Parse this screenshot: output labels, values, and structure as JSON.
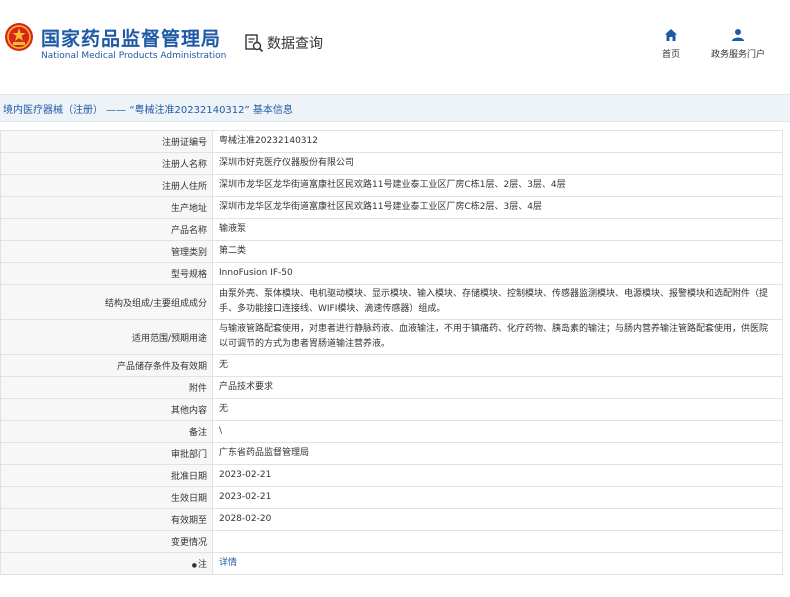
{
  "header": {
    "site_name_cn": "国家药品监督管理局",
    "site_name_en": "National Medical Products Administration",
    "query_title": "数据查询",
    "nav": [
      {
        "label": "首页",
        "icon": "home-icon"
      },
      {
        "label": "政务服务门户",
        "icon": "user-icon"
      }
    ]
  },
  "breadcrumb": "境内医疗器械（注册） —— “粤械注准20232140312” 基本信息",
  "rows": [
    {
      "label": "注册证编号",
      "value": "粤械注准20232140312"
    },
    {
      "label": "注册人名称",
      "value": "深圳市好克医疗仪器股份有限公司"
    },
    {
      "label": "注册人住所",
      "value": "深圳市龙华区龙华街道富康社区民欢路11号建业泰工业区厂房C栋1层、2层、3层、4层"
    },
    {
      "label": "生产地址",
      "value": "深圳市龙华区龙华街道富康社区民欢路11号建业泰工业区厂房C栋2层、3层、4层"
    },
    {
      "label": "产品名称",
      "value": "输液泵"
    },
    {
      "label": "管理类别",
      "value": "第二类"
    },
    {
      "label": "型号规格",
      "value": "InnoFusion IF-50"
    },
    {
      "label": "结构及组成/主要组成成分",
      "value": "由泵外壳、泵体模块、电机驱动模块、显示模块、输入模块、存储模块、控制模块、传感器监测模块、电源模块、报警模块和选配附件（提手、多功能接口连接线、WIFI模块、滴速传感器）组成。"
    },
    {
      "label": "适用范围/预期用途",
      "value": "与输液管路配套使用，对患者进行静脉药液、血液输注，不用于镇痛药、化疗药物、胰岛素的输注；与肠内营养输注管路配套使用，供医院以可调节的方式为患者胃肠道输注营养液。"
    },
    {
      "label": "产品储存条件及有效期",
      "value": "无"
    },
    {
      "label": "附件",
      "value": "产品技术要求"
    },
    {
      "label": "其他内容",
      "value": "无"
    },
    {
      "label": "备注",
      "value": "\\"
    },
    {
      "label": "审批部门",
      "value": "广东省药品监督管理局"
    },
    {
      "label": "批准日期",
      "value": "2023-02-21"
    },
    {
      "label": "生效日期",
      "value": "2023-02-21"
    },
    {
      "label": "有效期至",
      "value": "2028-02-20"
    },
    {
      "label": "变更情况",
      "value": ""
    }
  ],
  "note_row": {
    "label": "注",
    "value": "详情"
  }
}
